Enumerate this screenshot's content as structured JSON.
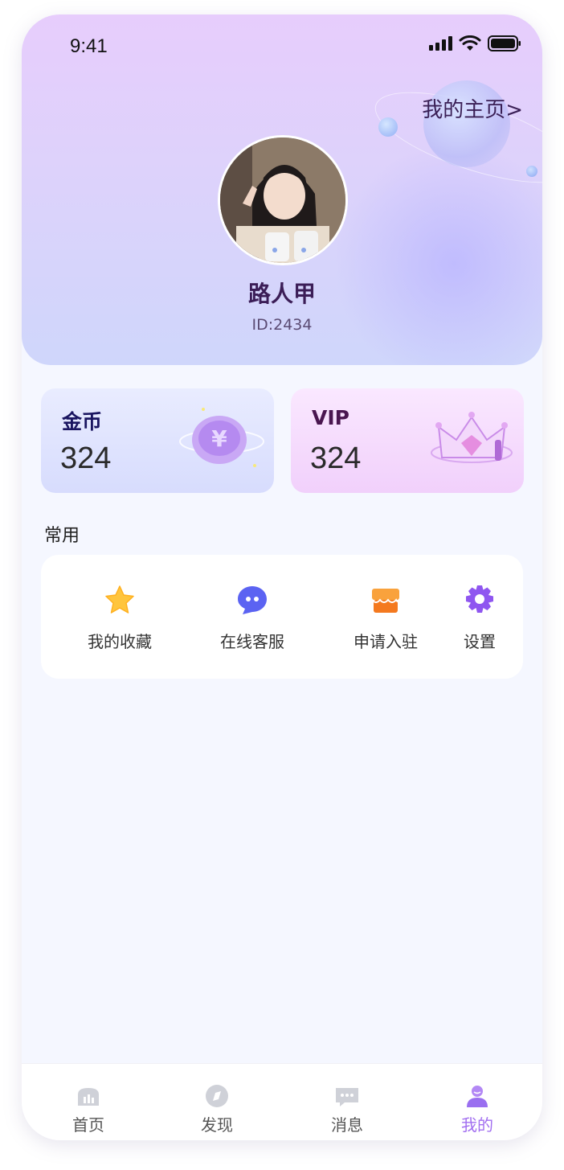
{
  "status_bar": {
    "time": "9:41"
  },
  "header": {
    "homepage_link": "我的主页>",
    "username": "路人甲",
    "user_id": "ID:2434"
  },
  "cards": {
    "coin": {
      "title": "金币",
      "value": "324"
    },
    "vip": {
      "title": "VIP",
      "value": "324"
    }
  },
  "common": {
    "title": "常用",
    "items": [
      {
        "label": "我的收藏",
        "icon": "star-icon"
      },
      {
        "label": "在线客服",
        "icon": "chat-icon"
      },
      {
        "label": "申请入驻",
        "icon": "shop-icon"
      },
      {
        "label": "设置",
        "icon": "gear-icon"
      }
    ]
  },
  "tabbar": {
    "active": "我的",
    "items": [
      {
        "label": "首页",
        "icon": "home-icon"
      },
      {
        "label": "发现",
        "icon": "discover-icon"
      },
      {
        "label": "消息",
        "icon": "message-icon"
      },
      {
        "label": "我的",
        "icon": "profile-icon"
      }
    ]
  },
  "colors": {
    "accent": "#a26ff0",
    "header_top": "#e7cdfc",
    "header_bottom": "#cfd6fb",
    "page_bg": "#f5f7ff"
  }
}
